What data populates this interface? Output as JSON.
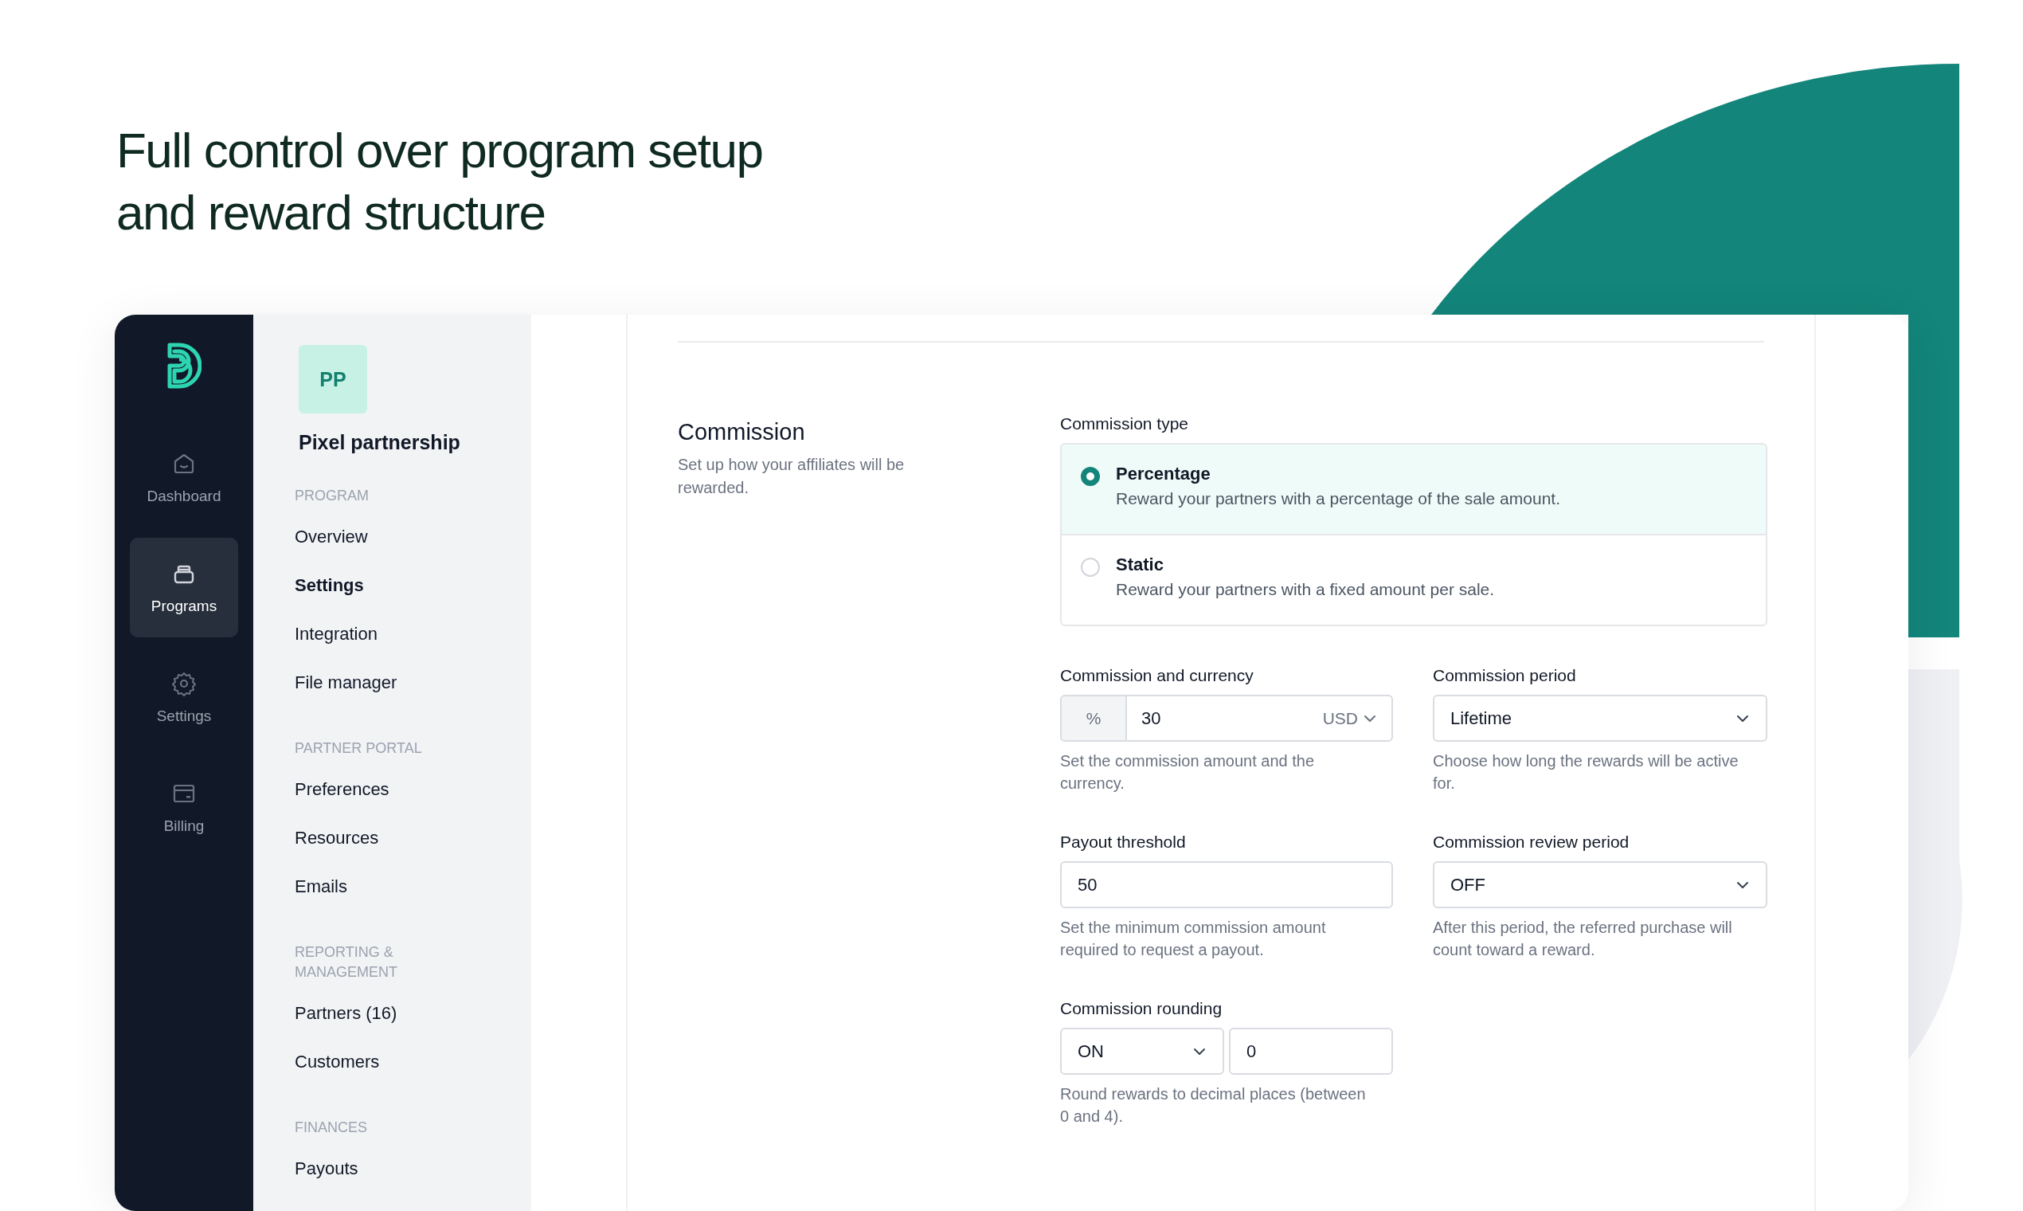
{
  "headline": "Full control over program setup\nand reward structure",
  "rail": {
    "items": [
      {
        "label": "Dashboard",
        "selected": false
      },
      {
        "label": "Programs",
        "selected": true
      },
      {
        "label": "Settings",
        "selected": false
      },
      {
        "label": "Billing",
        "selected": false
      }
    ]
  },
  "sidebar": {
    "avatar": "PP",
    "title": "Pixel partnership",
    "sections": [
      {
        "heading": "PROGRAM",
        "items": [
          {
            "label": "Overview",
            "selected": false
          },
          {
            "label": "Settings",
            "selected": true
          },
          {
            "label": "Integration",
            "selected": false
          },
          {
            "label": "File manager",
            "selected": false
          }
        ]
      },
      {
        "heading": "PARTNER PORTAL",
        "items": [
          {
            "label": "Preferences",
            "selected": false
          },
          {
            "label": "Resources",
            "selected": false
          },
          {
            "label": "Emails",
            "selected": false
          }
        ]
      },
      {
        "heading": "REPORTING & MANAGEMENT",
        "items": [
          {
            "label": "Partners (16)",
            "selected": false
          },
          {
            "label": "Customers",
            "selected": false
          }
        ]
      },
      {
        "heading": "FINANCES",
        "items": [
          {
            "label": "Payouts",
            "selected": false
          }
        ]
      }
    ]
  },
  "section": {
    "title": "Commission",
    "description": "Set up how your affiliates will be rewarded.",
    "commission_type": {
      "label": "Commission type",
      "options": [
        {
          "title": "Percentage",
          "description": "Reward your partners with a percentage of the sale amount.",
          "selected": true
        },
        {
          "title": "Static",
          "description": "Reward your partners with a fixed amount per sale.",
          "selected": false
        }
      ]
    },
    "fields": [
      {
        "kind": "amount_currency",
        "label": "Commission and currency",
        "prefix": "%",
        "value": "30",
        "currency": "USD",
        "help": "Set the commission amount and the currency."
      },
      {
        "kind": "select",
        "label": "Commission period",
        "value": "Lifetime",
        "help": "Choose how long the rewards will be active for."
      },
      {
        "kind": "text",
        "label": "Payout threshold",
        "value": "50",
        "help": "Set the minimum commission amount required to request a payout."
      },
      {
        "kind": "select",
        "label": "Commission review period",
        "value": "OFF",
        "help": "After this period, the referred purchase will count toward a reward."
      },
      {
        "kind": "rounding",
        "label": "Commission rounding",
        "mode": "ON",
        "value": "0",
        "help": "Round rewards to decimal places (between 0 and 4)."
      }
    ]
  }
}
